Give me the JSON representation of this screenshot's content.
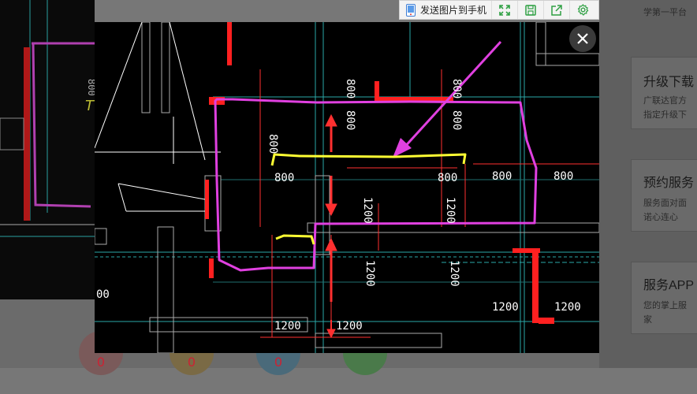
{
  "toolbar": {
    "send_to_phone_label": "发送图片到手机",
    "buttons": [
      "fullscreen-icon",
      "save-icon",
      "share-icon",
      "settings-icon"
    ]
  },
  "viewer": {
    "close_icon": "close-icon",
    "dimensions": {
      "d800_vertical": "800",
      "d800_horizontal": "800",
      "d1200_vertical": "1200",
      "d1200_horizontal": "1200",
      "d00": "00"
    }
  },
  "background": {
    "left_label": "800",
    "bubbles": [
      "0",
      "0",
      "0"
    ]
  },
  "right_panel": {
    "top_text": "学第一平台",
    "cards": [
      {
        "title": "升级下载",
        "desc": [
          "广联达官方",
          "指定升级下"
        ]
      },
      {
        "title": "预约服务",
        "desc": [
          "服务面对面",
          "诺心连心"
        ]
      },
      {
        "title": "服务APP",
        "desc": [
          "您的掌上服",
          "家"
        ]
      }
    ]
  },
  "colors": {
    "cad_background": "#000000",
    "annotation_magenta": "#e040e0",
    "annotation_yellow": "#ffff33",
    "cad_red": "#ff2020",
    "cad_cyan": "#33cccc",
    "cad_white": "#ffffff"
  }
}
